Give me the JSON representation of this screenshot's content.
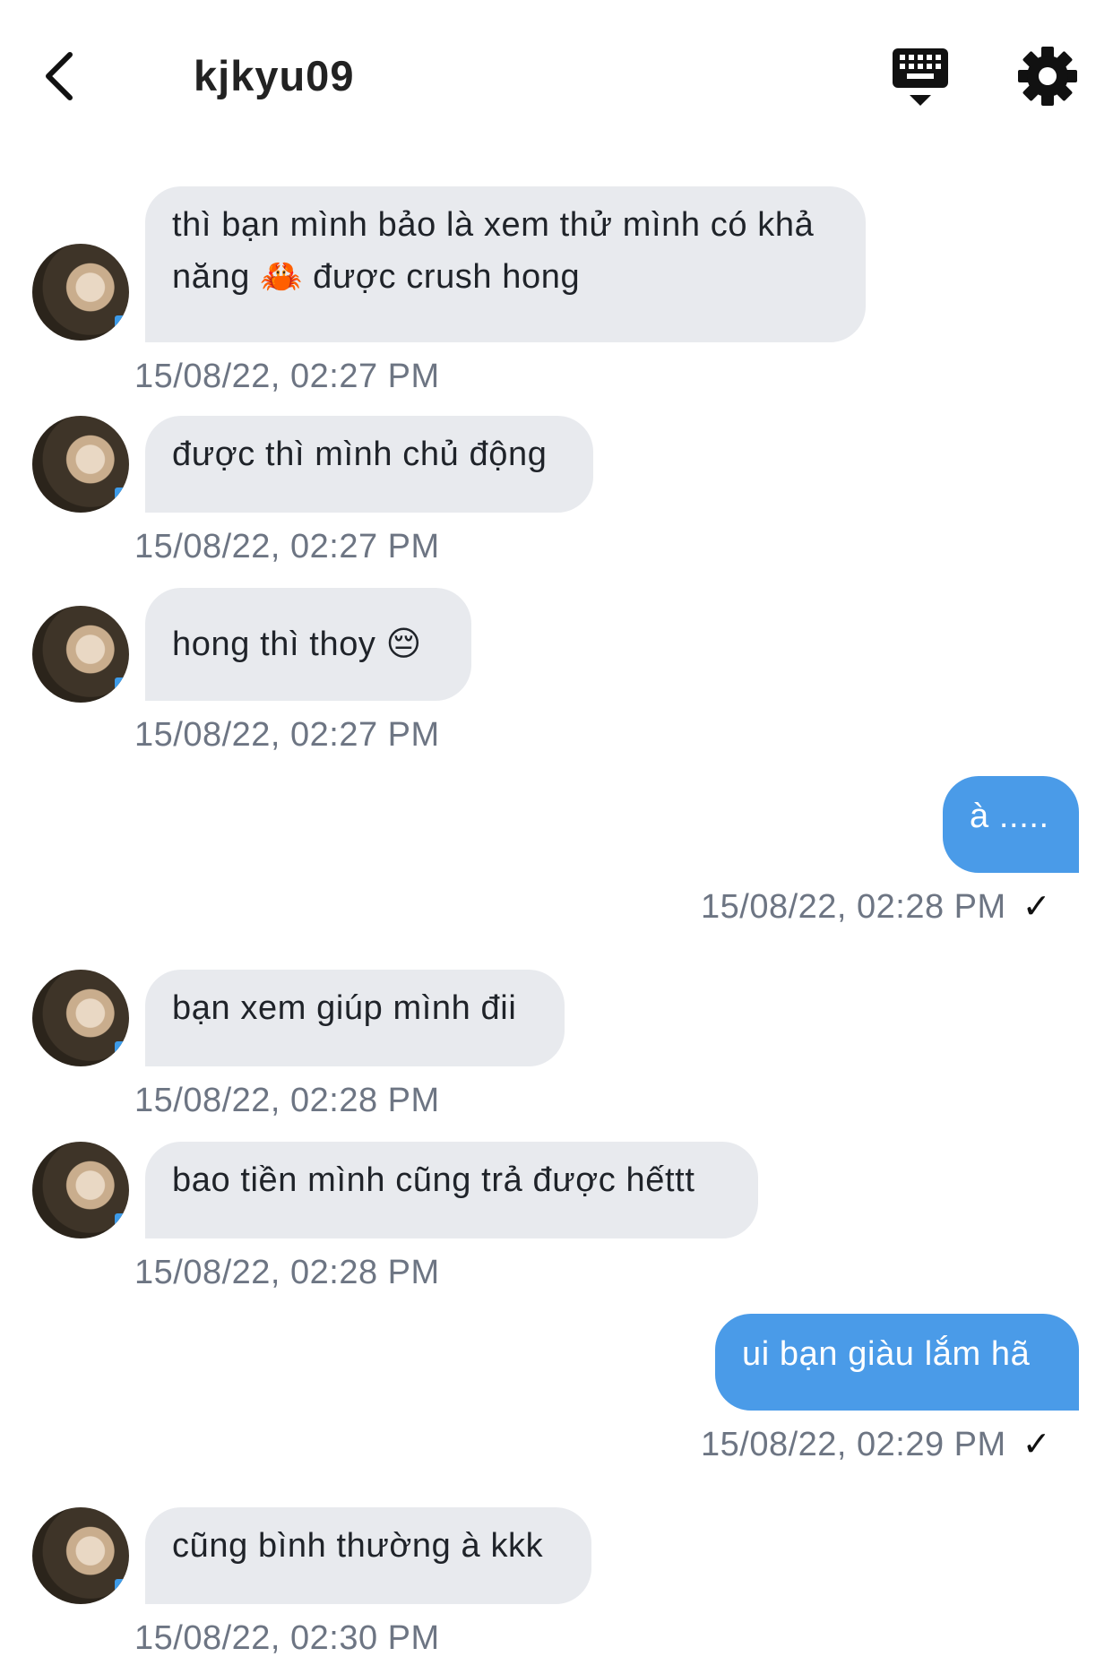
{
  "header": {
    "title": "kjkyu09"
  },
  "messages": [
    {
      "text": "thì bạn mình bảo là xem thử mình có khả năng 🦀 được crush hong",
      "time": "15/08/22, 02:27 PM"
    },
    {
      "text": "được thì mình chủ động",
      "time": "15/08/22, 02:27 PM"
    },
    {
      "text": "hong thì thoy 😔",
      "time": "15/08/22, 02:27 PM"
    },
    {
      "text": "à .....",
      "time": "15/08/22, 02:28 PM",
      "status": "✓"
    },
    {
      "text": "bạn xem giúp mình đii",
      "time": "15/08/22, 02:28 PM"
    },
    {
      "text": "bao tiền mình cũng trả được hếttt",
      "time": "15/08/22, 02:28 PM"
    },
    {
      "text": "ui bạn giàu lắm hã",
      "time": "15/08/22, 02:29 PM",
      "status": "✓"
    },
    {
      "text": "cũng bình thường à kkk",
      "time": "15/08/22, 02:30 PM"
    }
  ],
  "colors": {
    "incoming_bubble": "#e8eaee",
    "outgoing_bubble": "#4a9be8",
    "timestamp": "#6d7583"
  },
  "icons": {
    "back": "chevron-left-icon",
    "keyboard": "keyboard-hide-icon",
    "settings": "gear-icon"
  }
}
